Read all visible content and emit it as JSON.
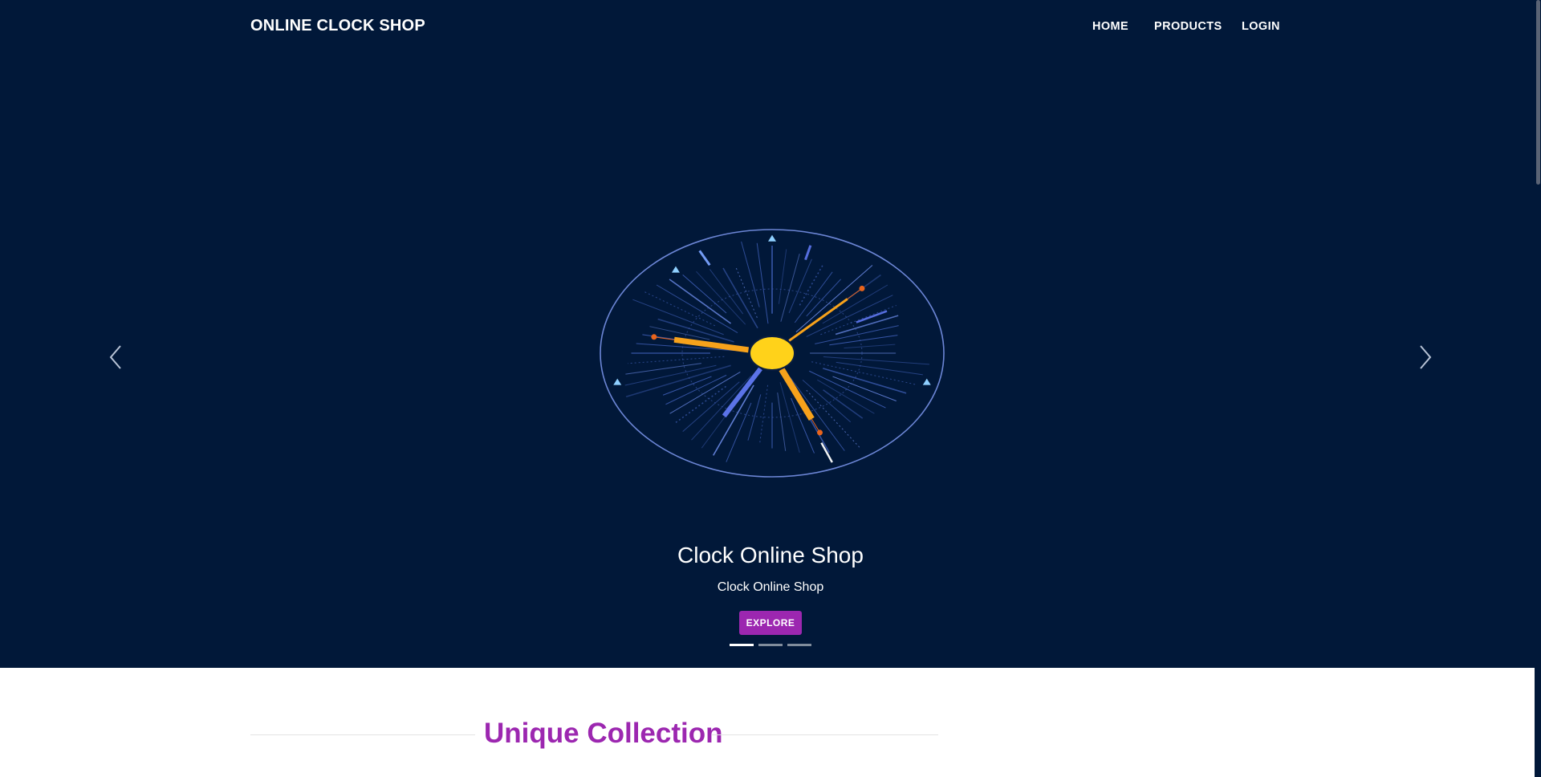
{
  "navbar": {
    "brand": "ONLINE CLOCK SHOP",
    "links": [
      {
        "label": "HOME"
      },
      {
        "label": "PRODUCTS"
      },
      {
        "label": "LOGIN"
      }
    ]
  },
  "carousel": {
    "slide": {
      "title": "Clock Online Shop",
      "subtitle": "Clock Online Shop",
      "button_label": "EXPLORE"
    },
    "active_index": 0,
    "slide_count": 3,
    "prev_icon": "chevron-left-icon",
    "next_icon": "chevron-right-icon"
  },
  "section": {
    "title": "Unique Collection"
  },
  "colors": {
    "hero_background": "#011839",
    "accent": "#9c27b0",
    "clock_center": "#ffd21a",
    "clock_hand": "#f7a21b",
    "clock_blue": "#5b73e8"
  }
}
